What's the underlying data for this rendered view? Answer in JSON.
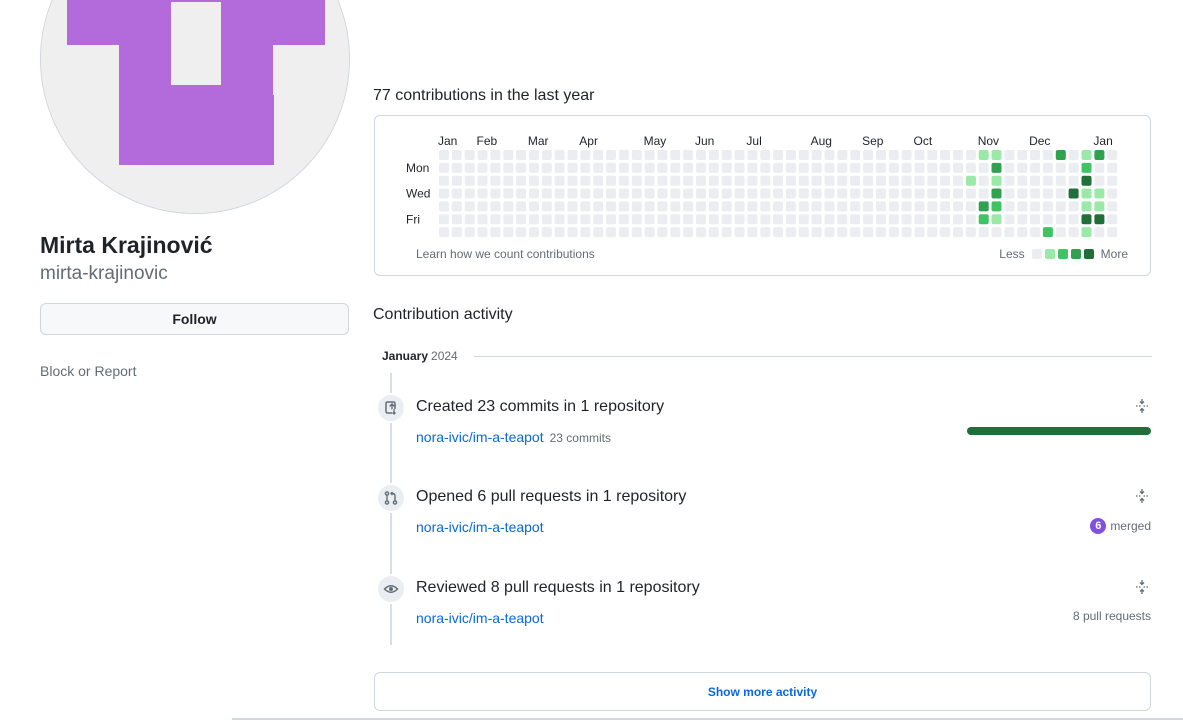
{
  "profile": {
    "name": "Mirta Krajinović",
    "login": "mirta-krajinovic",
    "follow_label": "Follow",
    "block_label": "Block or Report",
    "avatar_color": "#b36bdb"
  },
  "contributions": {
    "heading": "77 contributions in the last year",
    "months": [
      "Jan",
      "Feb",
      "Mar",
      "Apr",
      "May",
      "Jun",
      "Jul",
      "Aug",
      "Sep",
      "Oct",
      "Nov",
      "Dec",
      "Jan"
    ],
    "days": [
      "Mon",
      "Wed",
      "Fri"
    ],
    "learn_link": "Learn how we count contributions",
    "legend_less": "Less",
    "legend_more": "More",
    "colors": {
      "0": "#ebedf0",
      "1": "#9be9a8",
      "2": "#40c463",
      "3": "#30a14e",
      "4": "#216e39"
    },
    "active_cells": [
      {
        "week": 41,
        "day": 2,
        "level": 1
      },
      {
        "week": 42,
        "day": 0,
        "level": 1
      },
      {
        "week": 42,
        "day": 4,
        "level": 3
      },
      {
        "week": 42,
        "day": 5,
        "level": 2
      },
      {
        "week": 43,
        "day": 0,
        "level": 1
      },
      {
        "week": 43,
        "day": 1,
        "level": 3
      },
      {
        "week": 43,
        "day": 2,
        "level": 1
      },
      {
        "week": 43,
        "day": 3,
        "level": 3
      },
      {
        "week": 43,
        "day": 4,
        "level": 2
      },
      {
        "week": 43,
        "day": 5,
        "level": 1
      },
      {
        "week": 47,
        "day": 6,
        "level": 2
      },
      {
        "week": 48,
        "day": 0,
        "level": 3
      },
      {
        "week": 49,
        "day": 3,
        "level": 4
      },
      {
        "week": 50,
        "day": 0,
        "level": 1
      },
      {
        "week": 50,
        "day": 1,
        "level": 2
      },
      {
        "week": 50,
        "day": 2,
        "level": 4
      },
      {
        "week": 50,
        "day": 3,
        "level": 1
      },
      {
        "week": 50,
        "day": 4,
        "level": 1
      },
      {
        "week": 50,
        "day": 5,
        "level": 4
      },
      {
        "week": 50,
        "day": 6,
        "level": 1
      },
      {
        "week": 51,
        "day": 0,
        "level": 3
      },
      {
        "week": 51,
        "day": 3,
        "level": 1
      },
      {
        "week": 51,
        "day": 4,
        "level": 1
      },
      {
        "week": 51,
        "day": 5,
        "level": 4
      }
    ]
  },
  "activity": {
    "heading": "Contribution activity",
    "month": "January",
    "year": "2024",
    "items": [
      {
        "title": "Created 23 commits in 1 repository",
        "repo": "nora-ivic/im-a-teapot",
        "repo_count": "23 commits",
        "progress": 1.0
      },
      {
        "title": "Opened 6 pull requests in 1 repository",
        "repo": "nora-ivic/im-a-teapot",
        "merged_count": "6",
        "merged_label": "merged"
      },
      {
        "title": "Reviewed 8 pull requests in 1 repository",
        "repo": "nora-ivic/im-a-teapot",
        "right_text": "8 pull requests"
      }
    ],
    "show_more": "Show more activity"
  }
}
